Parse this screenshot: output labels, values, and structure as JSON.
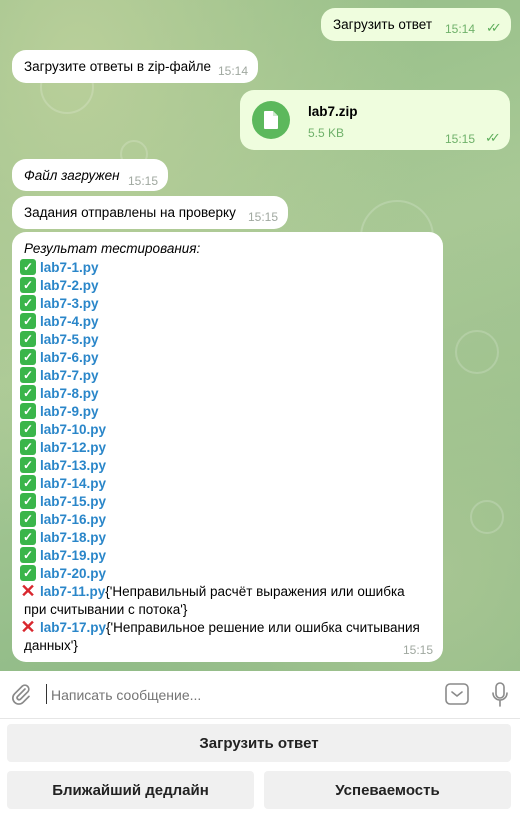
{
  "messages": {
    "m1": {
      "text": "Загрузить ответ",
      "time": "15:14"
    },
    "m2": {
      "text": "Загрузите ответы в zip-файле",
      "time": "15:14"
    },
    "m3": {
      "file_name": "lab7.zip",
      "file_size": "5.5 KB",
      "time": "15:15",
      "icon": "file-icon"
    },
    "m4": {
      "text": "Файл загружен",
      "time": "15:15"
    },
    "m5": {
      "text": "Задания отправлены на проверку",
      "time": "15:15"
    },
    "m6": {
      "header": "Результат тестирования:",
      "passed": [
        "lab7-1.py",
        "lab7-2.py",
        "lab7-3.py",
        "lab7-4.py",
        "lab7-5.py",
        "lab7-6.py",
        "lab7-7.py",
        "lab7-8.py",
        "lab7-9.py",
        "lab7-10.py",
        "lab7-12.py",
        "lab7-13.py",
        "lab7-14.py",
        "lab7-15.py",
        "lab7-16.py",
        "lab7-18.py",
        "lab7-19.py",
        "lab7-20.py"
      ],
      "failed": [
        {
          "file": "lab7-11.py",
          "line1": " {'Неправильный расчёт выражения или ошибка",
          "line2": "при считывании с потока'}"
        },
        {
          "file": "lab7-17.py",
          "line1": " {'Неправильное решение или ошибка считывания",
          "line2": "данных'}"
        }
      ],
      "time": "15:15"
    }
  },
  "input": {
    "placeholder": "Написать сообщение..."
  },
  "keyboard": {
    "upload": "Загрузить ответ",
    "deadline": "Ближайший дедлайн",
    "progress": "Успеваемость"
  },
  "colors": {
    "link": "#2a86c9",
    "check": "#3ab54a",
    "cross": "#d9272e",
    "outgoing": "#effdde"
  }
}
